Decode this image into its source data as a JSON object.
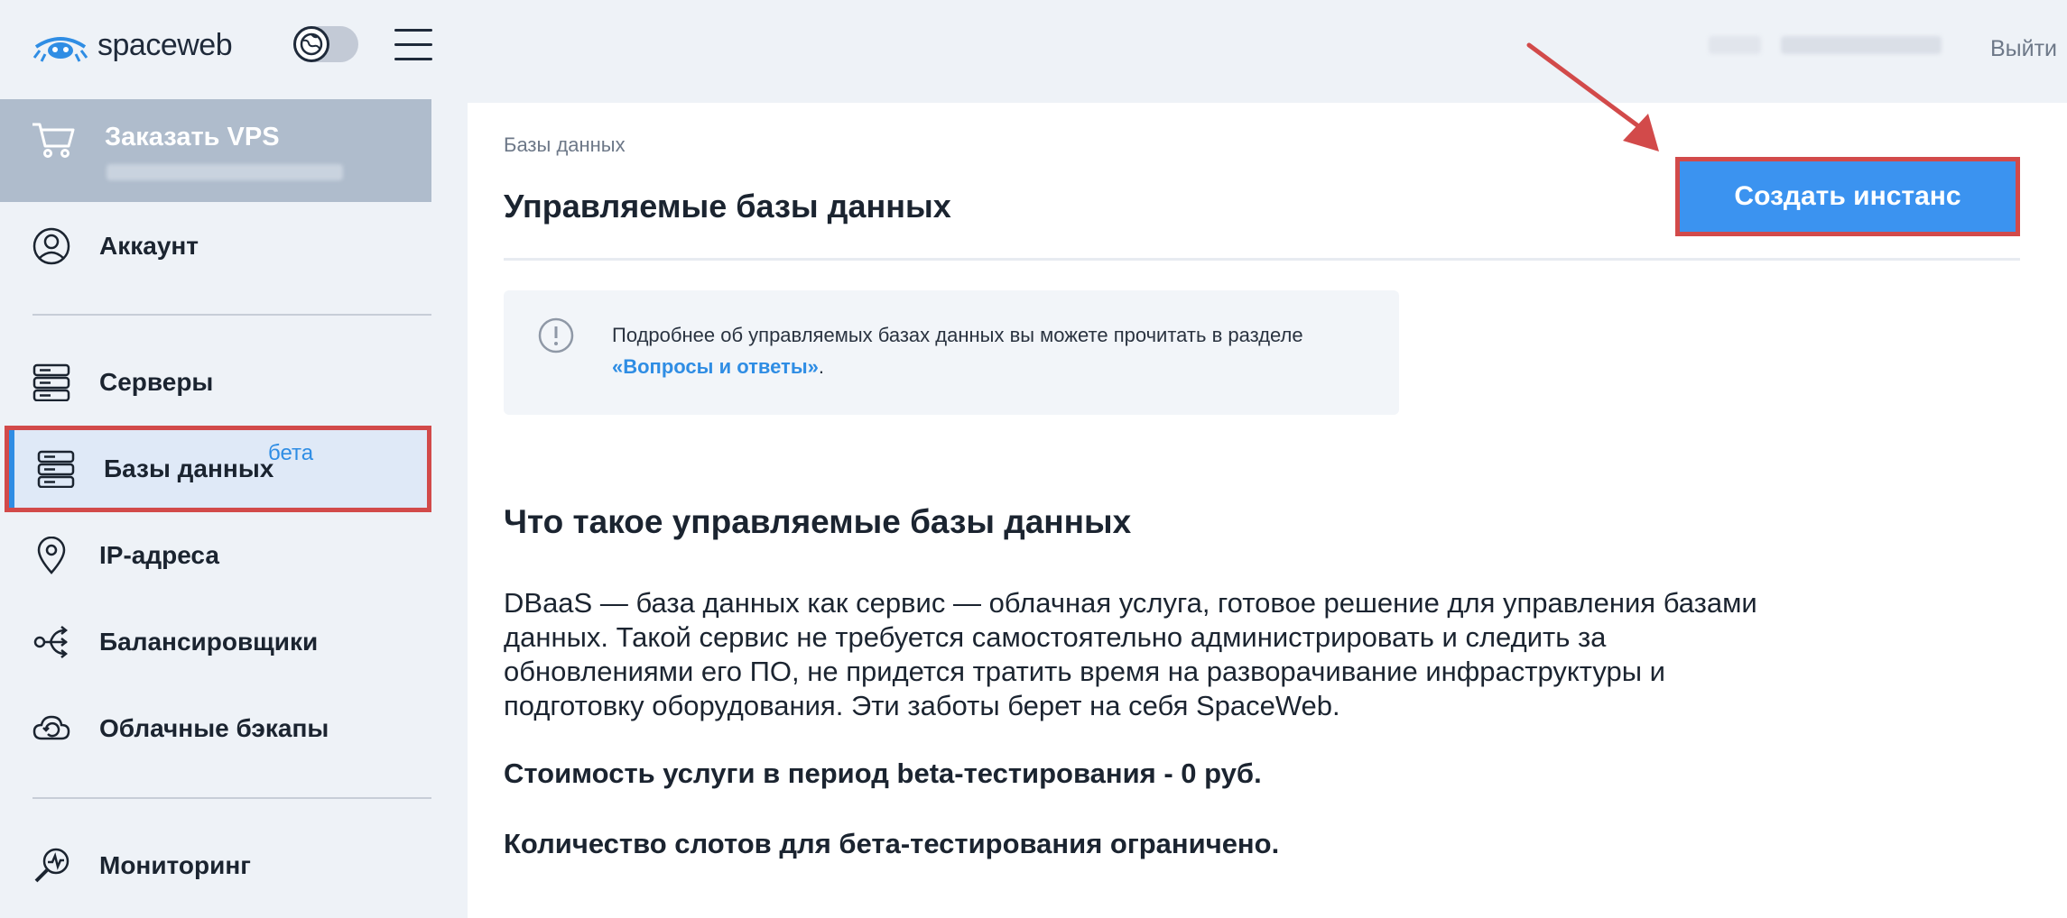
{
  "header": {
    "logo_text": "spaceweb",
    "logout_label": "Выйти"
  },
  "sidebar": {
    "order_vps": "Заказать VPS",
    "items": [
      {
        "id": "account",
        "label": "Аккаунт",
        "icon": "user-icon"
      },
      {
        "id": "servers",
        "label": "Серверы",
        "icon": "server-icon"
      },
      {
        "id": "databases",
        "label": "Базы данных",
        "icon": "database-icon",
        "badge": "бета",
        "active": true
      },
      {
        "id": "ip",
        "label": "IP-адреса",
        "icon": "location-pin-icon"
      },
      {
        "id": "balancers",
        "label": "Балансировщики",
        "icon": "load-balancer-icon"
      },
      {
        "id": "backups",
        "label": "Облачные бэкапы",
        "icon": "cloud-backup-icon"
      },
      {
        "id": "monitoring",
        "label": "Мониторинг",
        "icon": "monitoring-icon"
      }
    ]
  },
  "main": {
    "breadcrumb": "Базы данных",
    "title": "Управляемые базы данных",
    "create_button": "Создать инстанс",
    "info": {
      "text_before": "Подробнее об управляемых базах данных вы можете прочитать в разделе ",
      "link": "«Вопросы и ответы»",
      "text_after": "."
    },
    "section_title": "Что такое управляемые базы данных",
    "description": "DBaaS — база данных как сервис — облачная услуга, готовое решение для управления базами данных. Такой сервис не требуется самостоятельно администрировать и следить за обновлениями его ПО, не придется тратить время на разворачивание инфраструктуры и подготовку оборудования. Эти заботы берет на себя SpaceWeb.",
    "price_note": "Стоимость услуги в период beta-тестирования - 0 руб.",
    "slots_note": "Количество слотов для бета-тестирования ограничено."
  },
  "colors": {
    "accent": "#3b93f0",
    "highlight": "#d24a4a",
    "link": "#2f8de4"
  }
}
